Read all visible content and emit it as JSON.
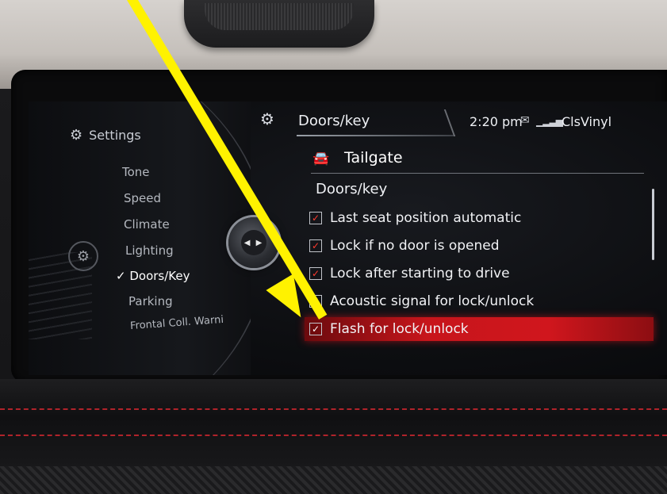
{
  "header": {
    "settings_icon": "settings-list-icon",
    "title": "Doors/key",
    "time": "2:20 pm",
    "mail_icon": "envelope-icon",
    "signal_icon": "signal-bars-icon",
    "station": "ClsVinyl"
  },
  "sidebar": {
    "title": "Settings",
    "title_icon": "gear-icon",
    "items": [
      {
        "label": "Tone",
        "active": false
      },
      {
        "label": "Speed",
        "active": false
      },
      {
        "label": "Climate",
        "active": false
      },
      {
        "label": "Lighting",
        "active": false
      },
      {
        "label": "Doors/Key",
        "active": true
      },
      {
        "label": "Parking",
        "active": false
      },
      {
        "label": "Frontal Coll. Warni",
        "active": false
      }
    ]
  },
  "main": {
    "section_icon": "car-icon",
    "section_title": "Tailgate",
    "subheading": "Doors/key",
    "options": [
      {
        "label": "Last seat position automatic",
        "checked": true,
        "highlighted": false
      },
      {
        "label": "Lock if no door is opened",
        "checked": true,
        "highlighted": false
      },
      {
        "label": "Lock after starting to drive",
        "checked": true,
        "highlighted": false
      },
      {
        "label": "Acoustic signal for lock/unlock",
        "checked": true,
        "highlighted": false
      },
      {
        "label": "Flash for lock/unlock",
        "checked": true,
        "highlighted": true
      }
    ]
  },
  "colors": {
    "highlight": "#d0161d",
    "arrow": "#fff200",
    "checkmark": "#ff3b2f"
  }
}
